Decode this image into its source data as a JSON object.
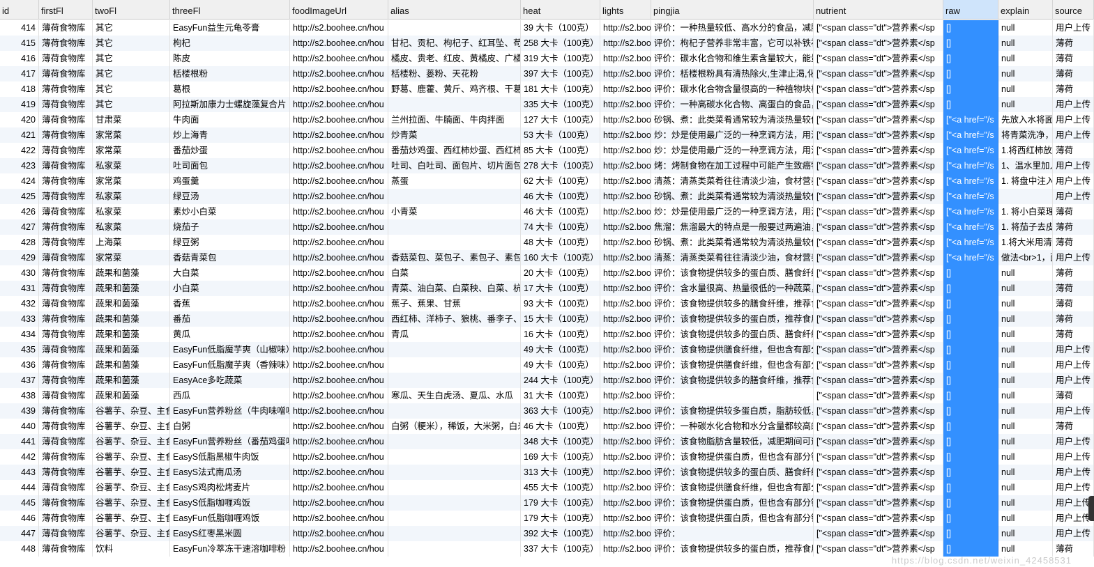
{
  "columns": [
    {
      "key": "id",
      "label": "id"
    },
    {
      "key": "firstFl",
      "label": "firstFl"
    },
    {
      "key": "twoFl",
      "label": "twoFl"
    },
    {
      "key": "threeFl",
      "label": "threeFl"
    },
    {
      "key": "foodImageUrl",
      "label": "foodImageUrl"
    },
    {
      "key": "alias",
      "label": "alias"
    },
    {
      "key": "heat",
      "label": "heat"
    },
    {
      "key": "lights",
      "label": "lights"
    },
    {
      "key": "pingjia",
      "label": "pingjia"
    },
    {
      "key": "nutrient",
      "label": "nutrient"
    },
    {
      "key": "raw",
      "label": "raw"
    },
    {
      "key": "explain",
      "label": "explain"
    },
    {
      "key": "source",
      "label": "source"
    }
  ],
  "rows": [
    [
      "414",
      "薄荷食物库",
      "其它",
      "EasyFun益生元龟苓膏",
      "http://s2.boohee.cn/hou",
      "",
      "39 大卡（100克）",
      "http://s2.boo",
      "评价：一种热量较低、高水分的食品，减肥期",
      "[\"<span class=\"dt\">营养素</sp",
      "[]",
      "null",
      "用户上传"
    ],
    [
      "415",
      "薄荷食物库",
      "其它",
      "枸杞",
      "http://s2.boohee.cn/hou",
      "甘杞、贡杞、枸杞子、红耳坠、苟起",
      "258 大卡（100克）",
      "http://s2.boo",
      "评价：枸杞子营养非常丰富，它可以补铁补血",
      "[\"<span class=\"dt\">营养素</sp",
      "[]",
      "null",
      "薄荷"
    ],
    [
      "416",
      "薄荷食物库",
      "其它",
      "陈皮",
      "http://s2.boohee.cn/hou",
      "橘皮、贵老、红皮、黄橘皮、广橘皮",
      "319 大卡（100克）",
      "http://s2.boo",
      "评价：碳水化合物和维生素含量较大，能量较",
      "[\"<span class=\"dt\">营养素</sp",
      "[]",
      "null",
      "薄荷"
    ],
    [
      "417",
      "薄荷食物库",
      "其它",
      "栝楼根粉",
      "http://s2.boohee.cn/hou",
      "栝楼粉、蒌粉、天花粉",
      "397 大卡（100克）",
      "http://s2.boo",
      "评价：栝楼根粉具有清热除火,生津止渴,化痰",
      "[\"<span class=\"dt\">营养素</sp",
      "[]",
      "null",
      "薄荷"
    ],
    [
      "418",
      "薄荷食物库",
      "其它",
      "葛根",
      "http://s2.boohee.cn/hou",
      "野葛、鹿藿、黄斤、鸡齐根、干葛、",
      "181 大卡（100克）",
      "http://s2.boo",
      "评价：碳水化合物含量很高的一种植物块根，",
      "[\"<span class=\"dt\">营养素</sp",
      "[]",
      "null",
      "薄荷"
    ],
    [
      "419",
      "薄荷食物库",
      "其它",
      "阿拉斯加康力士螺旋藻复合片",
      "http://s2.boohee.cn/hou",
      "",
      "335 大卡（100克）",
      "http://s2.boo",
      "评价：一种高碳水化合物、高蛋白的食品，减",
      "[\"<span class=\"dt\">营养素</sp",
      "[]",
      "null",
      "用户上传"
    ],
    [
      "420",
      "薄荷食物库",
      "甘肃菜",
      "牛肉面",
      "http://s2.boohee.cn/hou",
      "兰州拉面、牛腩面、牛肉拌面",
      "127 大卡（100克）",
      "http://s2.boo",
      "砂锅、煮：此类菜肴通常较为清淡热量较低",
      "[\"<span class=\"dt\">营养素</sp",
      "[\"<a href=\"/s",
      "先放入水将面条",
      "用户上传"
    ],
    [
      "421",
      "薄荷食物库",
      "家常菜",
      "炒上海青",
      "http://s2.boohee.cn/hou",
      "炒青菜",
      "53 大卡（100克）",
      "http://s2.boo",
      "炒：炒是使用最广泛的一种烹调方法，用油量",
      "[\"<span class=\"dt\">营养素</sp",
      "[\"<a href=\"/s",
      "将青菜洗净，切",
      "用户上传"
    ],
    [
      "422",
      "薄荷食物库",
      "家常菜",
      "番茄炒蛋",
      "http://s2.boohee.cn/hou",
      "番茄炒鸡蛋、西红柿炒蛋、西红柿炒",
      "85 大卡（100克）",
      "http://s2.boo",
      "炒：炒是使用最广泛的一种烹调方法，用油量",
      "[\"<span class=\"dt\">营养素</sp",
      "[\"<a href=\"/s",
      "1.将西红柿放在",
      "薄荷"
    ],
    [
      "423",
      "薄荷食物库",
      "私家菜",
      "吐司面包",
      "http://s2.boohee.cn/hou",
      "吐司、白吐司、面包片、切片面包、",
      "278 大卡（100克）",
      "http://s2.boo",
      "烤：烤制食物在加工过程中可能产生致癌物质",
      "[\"<span class=\"dt\">营养素</sp",
      "[\"<a href=\"/s",
      "1、温水里加入",
      "用户上传"
    ],
    [
      "424",
      "薄荷食物库",
      "家常菜",
      "鸡蛋羹",
      "http://s2.boohee.cn/hou",
      "蒸蛋",
      "62 大卡（100克）",
      "http://s2.boo",
      "清蒸：清蒸类菜肴往往清淡少油，食材营养保",
      "[\"<span class=\"dt\">营养素</sp",
      "[\"<a href=\"/s",
      "1. 将盘中注入",
      "用户上传"
    ],
    [
      "425",
      "薄荷食物库",
      "私家菜",
      "绿豆汤",
      "http://s2.boohee.cn/hou",
      "",
      "46 大卡（100克）",
      "http://s2.boo",
      "砂锅、煮：此类菜肴通常较为清淡热量较低",
      "[\"<span class=\"dt\">营养素</sp",
      "[\"<a href=\"/s",
      "",
      "用户上传"
    ],
    [
      "426",
      "薄荷食物库",
      "私家菜",
      "素炒小白菜",
      "http://s2.boohee.cn/hou",
      "小青菜",
      "46 大卡（100克）",
      "http://s2.boo",
      "炒：炒是使用最广泛的一种烹调方法，用油量",
      "[\"<span class=\"dt\">营养素</sp",
      "[\"<a href=\"/s",
      "1. 将小白菜理",
      "薄荷"
    ],
    [
      "427",
      "薄荷食物库",
      "私家菜",
      "烧茄子",
      "http://s2.boohee.cn/hou",
      "",
      "74 大卡（100克）",
      "http://s2.boo",
      "焦溜：焦溜最大的特点是一般要过两遍油，热",
      "[\"<span class=\"dt\">营养素</sp",
      "[\"<a href=\"/s",
      "1. 将茄子去皮",
      "薄荷"
    ],
    [
      "428",
      "薄荷食物库",
      "上海菜",
      "绿豆粥",
      "http://s2.boohee.cn/hou",
      "",
      "48 大卡（100克）",
      "http://s2.boo",
      "砂锅、煮：此类菜肴通常较为清淡热量较低",
      "[\"<span class=\"dt\">营养素</sp",
      "[\"<a href=\"/s",
      "1.将大米用清水",
      "薄荷"
    ],
    [
      "429",
      "薄荷食物库",
      "家常菜",
      "香菇青菜包",
      "http://s2.boohee.cn/hou",
      "香菇菜包、菜包子、素包子、素包。",
      "160 大卡（100克）",
      "http://s2.boo",
      "清蒸：清蒸类菜肴往往清淡少油，食材营养保",
      "[\"<span class=\"dt\">营养素</sp",
      "[\"<a href=\"/s",
      "做法<br>1，面",
      "用户上传"
    ],
    [
      "430",
      "薄荷食物库",
      "蔬果和菌藻",
      "大白菜",
      "http://s2.boohee.cn/hou",
      "白菜",
      "20 大卡（100克）",
      "http://s2.boo",
      "评价：该食物提供较多的蛋白质、膳食纤维、",
      "[\"<span class=\"dt\">营养素</sp",
      "[]",
      "null",
      "薄荷"
    ],
    [
      "431",
      "薄荷食物库",
      "蔬果和菌藻",
      "小白菜",
      "http://s2.boohee.cn/hou",
      "青菜、油白菜、白菜秧、白菜、杭白",
      "17 大卡（100克）",
      "http://s2.boo",
      "评价：含水量很高、热量很低的一种蔬菜，富",
      "[\"<span class=\"dt\">营养素</sp",
      "[]",
      "null",
      "薄荷"
    ],
    [
      "432",
      "薄荷食物库",
      "蔬果和菌藻",
      "香蕉",
      "http://s2.boohee.cn/hou",
      "蕉子、蕉果、甘蕉",
      "93 大卡（100克）",
      "http://s2.boo",
      "评价：该食物提供较多的膳食纤维，推荐食用",
      "[\"<span class=\"dt\">营养素</sp",
      "[]",
      "null",
      "薄荷"
    ],
    [
      "433",
      "薄荷食物库",
      "蔬果和菌藻",
      "番茄",
      "http://s2.boohee.cn/hou",
      "西红柿、洋柿子、狼桃、番李子、金",
      "15 大卡（100克）",
      "http://s2.boo",
      "评价：该食物提供较多的蛋白质，推荐食用。",
      "[\"<span class=\"dt\">营养素</sp",
      "[]",
      "null",
      "薄荷"
    ],
    [
      "434",
      "薄荷食物库",
      "蔬果和菌藻",
      "黄瓜",
      "http://s2.boohee.cn/hou",
      "青瓜",
      "16 大卡（100克）",
      "http://s2.boo",
      "评价：该食物提供较多的蛋白质、膳食纤维，",
      "[\"<span class=\"dt\">营养素</sp",
      "[]",
      "null",
      "薄荷"
    ],
    [
      "435",
      "薄荷食物库",
      "蔬果和菌藻",
      "EasyFun低脂魔芋爽（山椒味）",
      "http://s2.boohee.cn/hou",
      "",
      "49 大卡（100克）",
      "http://s2.boo",
      "评价：该食物提供膳食纤维，但也含有部分钠",
      "[\"<span class=\"dt\">营养素</sp",
      "[]",
      "null",
      "用户上传"
    ],
    [
      "436",
      "薄荷食物库",
      "蔬果和菌藻",
      "EasyFun低脂魔芋爽（香辣味）",
      "http://s2.boohee.cn/hou",
      "",
      "49 大卡（100克）",
      "http://s2.boo",
      "评价：该食物提供膳食纤维，但也含有部分钠",
      "[\"<span class=\"dt\">营养素</sp",
      "[]",
      "null",
      "用户上传"
    ],
    [
      "437",
      "薄荷食物库",
      "蔬果和菌藻",
      "EasyAce多吃蔬菜",
      "http://s2.boohee.cn/hou",
      "",
      "244 大卡（100克）",
      "http://s2.boo",
      "评价：该食物提供较多的膳食纤维，推荐食用",
      "[\"<span class=\"dt\">营养素</sp",
      "[]",
      "null",
      "用户上传"
    ],
    [
      "438",
      "薄荷食物库",
      "蔬果和菌藻",
      "西瓜",
      "http://s2.boohee.cn/hou",
      "寒瓜、天生白虎汤、夏瓜、水瓜",
      "31 大卡（100克）",
      "http://s2.boo",
      "评价：",
      "[\"<span class=\"dt\">营养素</sp",
      "[]",
      "null",
      "薄荷"
    ],
    [
      "439",
      "薄荷食物库",
      "谷薯芋、杂豆、主食",
      "EasyFun营养粉丝（牛肉味噌味",
      "http://s2.boohee.cn/hou",
      "",
      "363 大卡（100克）",
      "http://s2.boo",
      "评价：该食物提供较多蛋白质，脂肪较低，减",
      "[\"<span class=\"dt\">营养素</sp",
      "[]",
      "null",
      "用户上传"
    ],
    [
      "440",
      "薄荷食物库",
      "谷薯芋、杂豆、主食",
      "白粥",
      "http://s2.boohee.cn/hou",
      "白粥（粳米），稀饭，大米粥，白米",
      "46 大卡（100克）",
      "http://s2.boo",
      "评价：一种碳水化合物和水分含量都较高的食",
      "[\"<span class=\"dt\">营养素</sp",
      "[]",
      "null",
      "薄荷"
    ],
    [
      "441",
      "薄荷食物库",
      "谷薯芋、杂豆、主食",
      "EasyFun营养粉丝（番茄鸡蛋味",
      "http://s2.boohee.cn/hou",
      "",
      "348 大卡（100克）",
      "http://s2.boo",
      "评价：该食物脂肪含量较低，减肥期间可适量",
      "[\"<span class=\"dt\">营养素</sp",
      "[]",
      "null",
      "用户上传"
    ],
    [
      "442",
      "薄荷食物库",
      "谷薯芋、杂豆、主食",
      "EasyS低脂黑椒牛肉饭",
      "http://s2.boohee.cn/hou",
      "",
      "169 大卡（100克）",
      "http://s2.boo",
      "评价：该食物提供蛋白质，但也含有部分钠，",
      "[\"<span class=\"dt\">营养素</sp",
      "[]",
      "null",
      "用户上传"
    ],
    [
      "443",
      "薄荷食物库",
      "谷薯芋、杂豆、主食",
      "EasyS法式南瓜汤",
      "http://s2.boohee.cn/hou",
      "",
      "313 大卡（100克）",
      "http://s2.boo",
      "评价：该食物提供较多的蛋白质、膳食纤维，",
      "[\"<span class=\"dt\">营养素</sp",
      "[]",
      "null",
      "用户上传"
    ],
    [
      "444",
      "薄荷食物库",
      "谷薯芋、杂豆、主食",
      "EasyS鸡肉松烤麦片",
      "http://s2.boohee.cn/hou",
      "",
      "455 大卡（100克）",
      "http://s2.boo",
      "评价：该食物提供膳食纤维，但也含有部分脂",
      "[\"<span class=\"dt\">营养素</sp",
      "[]",
      "null",
      "用户上传"
    ],
    [
      "445",
      "薄荷食物库",
      "谷薯芋、杂豆、主食",
      "EasyS低脂咖喱鸡饭",
      "http://s2.boohee.cn/hou",
      "",
      "179 大卡（100克）",
      "http://s2.boo",
      "评价：该食物提供蛋白质，但也含有部分钠，",
      "[\"<span class=\"dt\">营养素</sp",
      "[]",
      "null",
      "用户上传"
    ],
    [
      "446",
      "薄荷食物库",
      "谷薯芋、杂豆、主食",
      "EasyFun低脂咖喱鸡饭",
      "http://s2.boohee.cn/hou",
      "",
      "179 大卡（100克）",
      "http://s2.boo",
      "评价：该食物提供蛋白质，但也含有部分钠，",
      "[\"<span class=\"dt\">营养素</sp",
      "[]",
      "null",
      "用户上传"
    ],
    [
      "447",
      "薄荷食物库",
      "谷薯芋、杂豆、主食",
      "EasyS红枣黑米圆",
      "http://s2.boohee.cn/hou",
      "",
      "392 大卡（100克）",
      "http://s2.boo",
      "评价：",
      "[\"<span class=\"dt\">营养素</sp",
      "[]",
      "null",
      "用户上传"
    ],
    [
      "448",
      "薄荷食物库",
      "饮料",
      "EasyFun冷萃冻干速溶咖啡粉",
      "http://s2.boohee.cn/hou",
      "",
      "337 大卡（100克）",
      "http://s2.boo",
      "评价：该食物提供较多的蛋白质，推荐食用。",
      "[\"<span class=\"dt\">营养素</sp",
      "[]",
      "null",
      "薄荷"
    ]
  ],
  "selected_column": "raw",
  "colors": {
    "selection": "#3390ff",
    "header": "#f0f0f0",
    "alt_row": "#f2f6fb"
  },
  "watermark": "https://blog.csdn.net/weixin_42458531"
}
